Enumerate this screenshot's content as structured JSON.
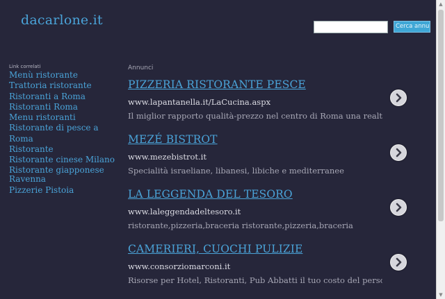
{
  "header": {
    "logo_text": "dacarlone.it",
    "search": {
      "placeholder": "",
      "value": "",
      "button_label": "Cerca annunci"
    }
  },
  "sidebar": {
    "heading": "Link correlati",
    "items": [
      {
        "label": "Menù ristorante"
      },
      {
        "label": "Trattoria ristorante"
      },
      {
        "label": "Ristoranti a Roma"
      },
      {
        "label": "Ristoranti Roma"
      },
      {
        "label": "Menu ristoranti"
      },
      {
        "label": "Ristorante di pesce a Roma"
      },
      {
        "label": "Ristorante"
      },
      {
        "label": "Ristorante cinese Milano"
      },
      {
        "label": "Ristorante giapponese Ravenna"
      },
      {
        "label": "Pizzerie Pistoia"
      }
    ]
  },
  "ads": {
    "heading": "Annunci",
    "items": [
      {
        "title": "PIZZERIA RISTORANTE PESCE",
        "url": "www.lapantanella.it/LaCucina.aspx",
        "description": "Il miglior rapporto qualità-prezzo nel centro di Roma una realtà che p"
      },
      {
        "title": "MEZÉ BISTROT",
        "url": "www.mezebistrot.it",
        "description": "Specialità israeliane, libanesi, libiche e mediterranee"
      },
      {
        "title": "LA LEGGENDA DEL TESORO",
        "url": "www.laleggendadeltesoro.it",
        "description": "ristorante,pizzeria,braceria ristorante,pizzeria,braceria"
      },
      {
        "title": "CAMERIERI, CUOCHI PULIZIE",
        "url": "www.consorziomarconi.it",
        "description": "Risorse per Hotel, Ristoranti, Pub Abbatti il tuo costo del personale"
      }
    ]
  },
  "colors": {
    "background": "#26263a",
    "accent": "#4aa3d8",
    "button": "#3fa7d6"
  },
  "icons": {
    "ad_arrow": "chevron-right-circle-icon"
  }
}
